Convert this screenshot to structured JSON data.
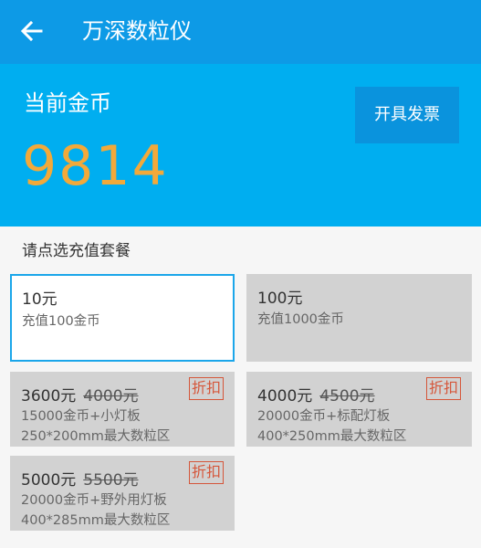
{
  "header": {
    "title": "万深数粒仪",
    "back_icon": "arrow-left-icon"
  },
  "coins": {
    "label": "当前金币",
    "value": "9814",
    "invoice_button": "开具发票"
  },
  "packages": {
    "hint": "请点选充值套餐",
    "items": [
      {
        "price": "10元",
        "original_price": "",
        "lines": [
          "充值100金币"
        ],
        "badge": "",
        "selected": true
      },
      {
        "price": "100元",
        "original_price": "",
        "lines": [
          "充值1000金币"
        ],
        "badge": "",
        "selected": false
      },
      {
        "price": "3600元",
        "original_price": "4000元",
        "lines": [
          "15000金币+小灯板",
          "250*200mm最大数粒区"
        ],
        "badge": "折扣",
        "selected": false
      },
      {
        "price": "4000元",
        "original_price": "4500元",
        "lines": [
          "20000金币+标配灯板",
          "400*250mm最大数粒区"
        ],
        "badge": "折扣",
        "selected": false
      },
      {
        "price": "5000元",
        "original_price": "5500元",
        "lines": [
          "20000金币+野外用灯板",
          "400*285mm最大数粒区"
        ],
        "badge": "折扣",
        "selected": false
      }
    ]
  },
  "colors": {
    "appbar": "#0d9ae6",
    "panel": "#00aef0",
    "coin_value": "#f2a93a",
    "selected_border": "#1ba6ea",
    "badge": "#d5563a"
  }
}
